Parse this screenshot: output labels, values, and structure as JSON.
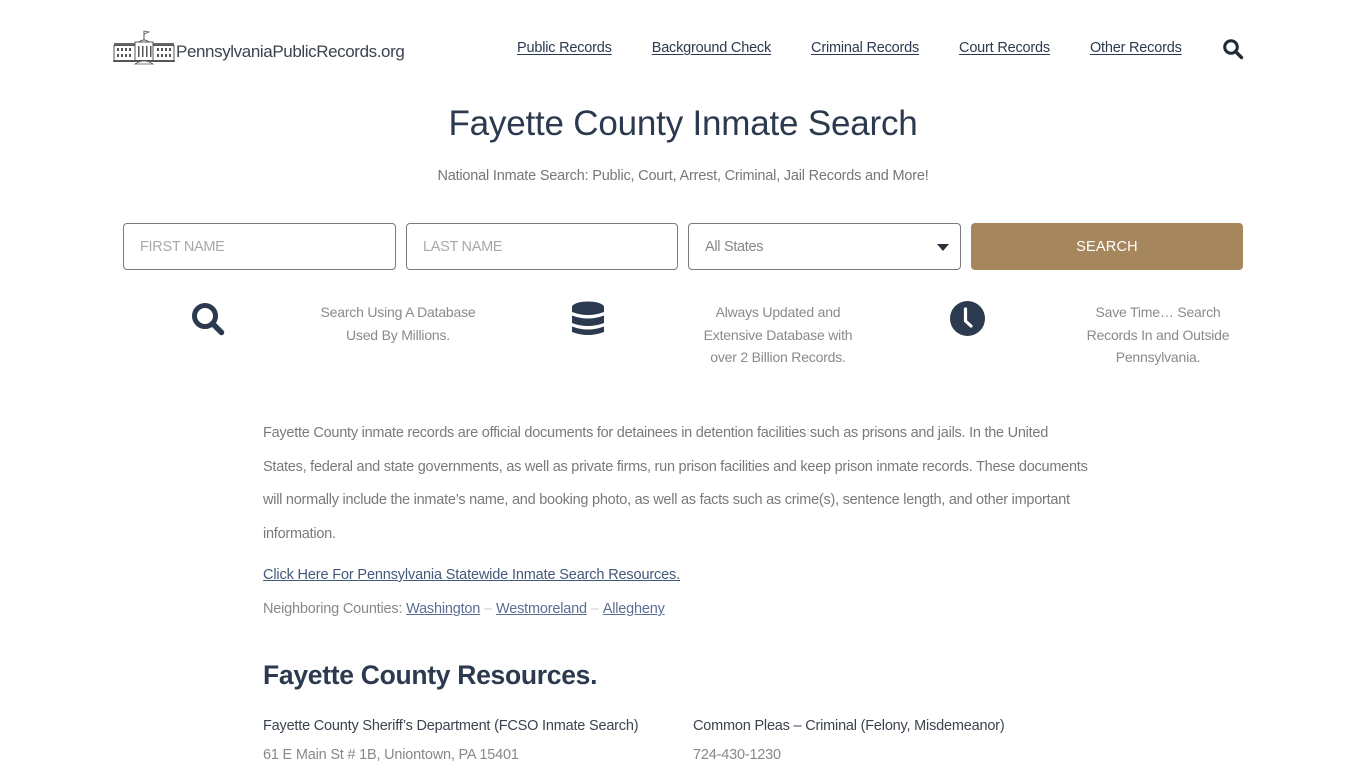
{
  "header": {
    "logo_text": "PennsylvaniaPublicRecords.org",
    "nav": [
      {
        "label": "Public Records"
      },
      {
        "label": "Background Check"
      },
      {
        "label": "Criminal Records"
      },
      {
        "label": "Court Records"
      },
      {
        "label": "Other Records"
      }
    ],
    "search_icon": "search-icon"
  },
  "hero": {
    "title": "Fayette County Inmate Search",
    "subtitle": "National Inmate Search: Public, Court, Arrest, Criminal, Jail Records and More!"
  },
  "search_form": {
    "first_name_placeholder": "FIRST NAME",
    "first_name_value": "",
    "last_name_placeholder": "LAST NAME",
    "last_name_value": "",
    "state_selected": "All States",
    "submit_label": "SEARCH",
    "accent_color": "#a6865d"
  },
  "features": [
    {
      "icon": "search-icon",
      "line1": "Search Using A Database",
      "line2": "Used By Millions.",
      "line3": ""
    },
    {
      "icon": "database-icon",
      "line1": "Always Updated and",
      "line2": "Extensive Database with",
      "line3": "over 2 Billion Records."
    },
    {
      "icon": "clock-icon",
      "line1": "Save Time… Search",
      "line2": "Records In and Outside",
      "line3": "Pennsylvania."
    }
  ],
  "content": {
    "paragraph": "Fayette County inmate records are official documents for detainees in detention facilities such as prisons and jails. In the United States, federal and state governments, as well as private firms, run prison facilities and keep prison inmate records. These documents will normally include the inmate’s name, and booking photo, as well as facts such as crime(s), sentence length, and other important information.",
    "statewide_link": "Click Here For Pennsylvania Statewide Inmate Search Resources.",
    "neighbors_label": "Neighboring Counties:",
    "neighbors": [
      "Washington",
      "Westmoreland",
      "Allegheny"
    ],
    "separator": "–"
  },
  "resources": {
    "title": "Fayette County Resources.",
    "items": [
      {
        "name": "Fayette County Sheriff’s Department (FCSO Inmate Search)",
        "detail": "61 E Main St # 1B, Uniontown, PA 15401"
      },
      {
        "name": "Common Pleas – Criminal (Felony, Misdemeanor)",
        "detail": "724-430-1230"
      }
    ]
  }
}
